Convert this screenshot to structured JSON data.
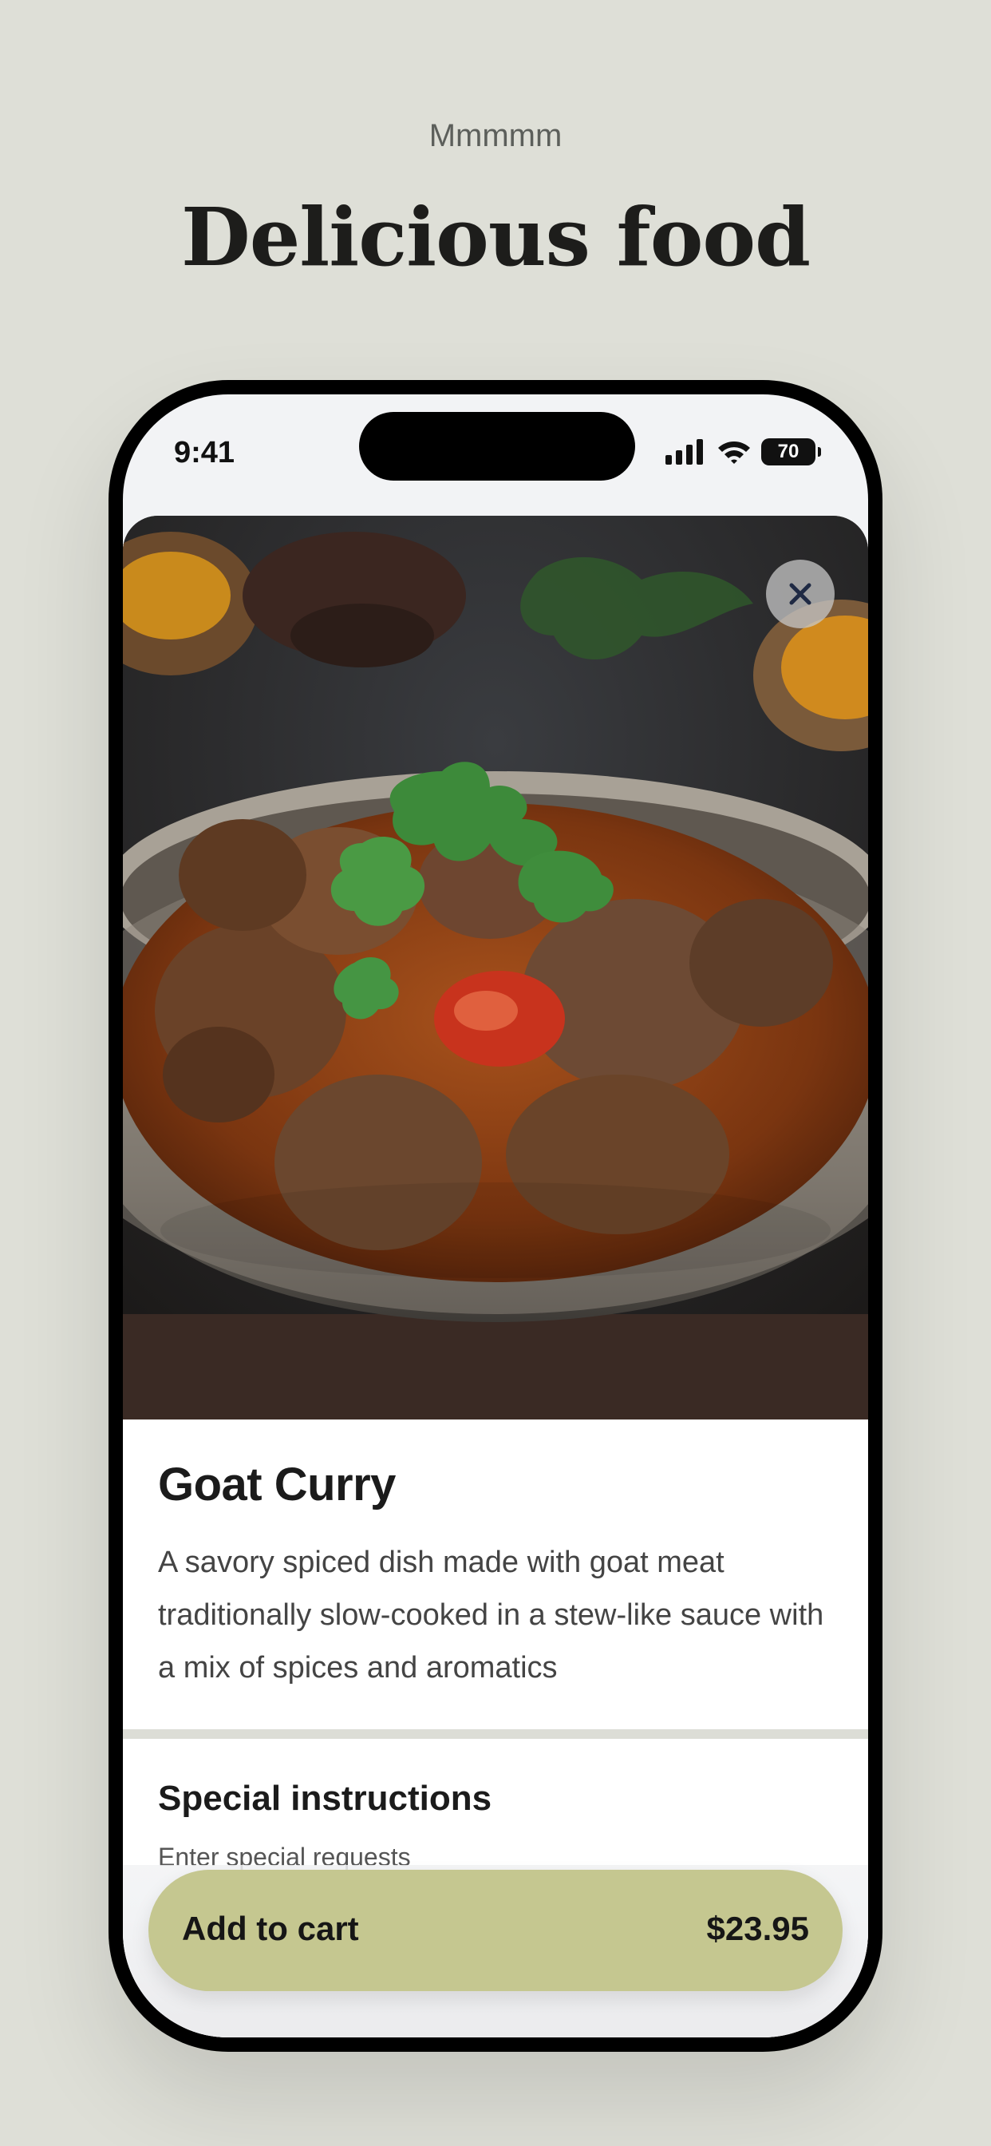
{
  "header": {
    "kicker": "Mmmmm",
    "headline": "Delicious food"
  },
  "status_bar": {
    "time": "9:41",
    "battery": "70",
    "icons": [
      "signal-icon",
      "wifi-icon",
      "battery-icon"
    ]
  },
  "item": {
    "image": "goat-curry-photo",
    "title": "Goat Curry",
    "description": "A savory spiced dish made with goat meat traditionally slow-cooked in a stew-like sauce with a mix of spices and aromatics"
  },
  "special_instructions": {
    "title": "Special instructions",
    "placeholder": "Enter special requests"
  },
  "cart_button": {
    "label": "Add to cart",
    "price": "$23.95"
  },
  "colors": {
    "background": "#dedfd7",
    "accent": "#c5c790",
    "text": "#1b1b1b"
  }
}
